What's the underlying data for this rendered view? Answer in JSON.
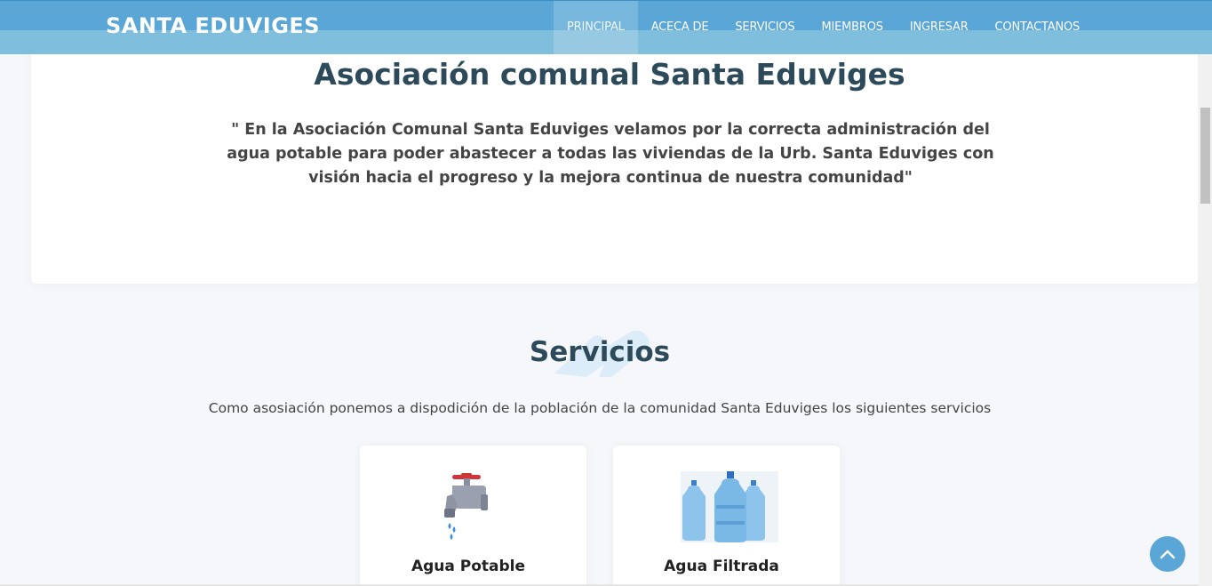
{
  "header": {
    "logo": "SANTA EDUVIGES",
    "nav": [
      {
        "label": "PRINCIPAL",
        "active": true
      },
      {
        "label": "ACECA DE",
        "active": false
      },
      {
        "label": "SERVICIOS",
        "active": false
      },
      {
        "label": "MIEMBROS",
        "active": false
      },
      {
        "label": "INGRESAR",
        "active": false
      },
      {
        "label": "CONTACTANOS",
        "active": false
      }
    ]
  },
  "about": {
    "title": "Asociación comunal Santa Eduviges",
    "quote": "\" En la Asociación Comunal Santa Eduviges velamos por la correcta administración del agua potable para poder abastecer a todas las viviendas de la Urb. Santa Eduviges con visión hacia el progreso y la mejora continua de nuestra comunidad\""
  },
  "services": {
    "title": "Servicios",
    "description": "Como asosiación ponemos a dispodición de la población de la comunidad Santa Eduviges los siguientes servicios",
    "items": [
      {
        "title": "Agua Potable",
        "icon": "water-faucet-icon"
      },
      {
        "title": "Agua Filtrada",
        "icon": "water-bottles-icon"
      }
    ]
  },
  "colors": {
    "header": "#5aa6d6",
    "heading": "#2d4a5a",
    "back_to_top": "#5aa6d6"
  },
  "back_to_top": {
    "icon": "chevron-up-icon"
  }
}
